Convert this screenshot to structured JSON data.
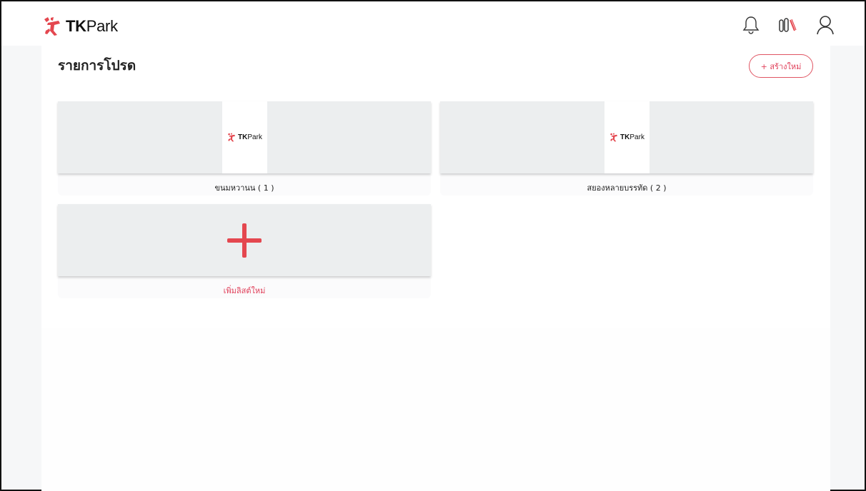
{
  "header": {
    "logo": {
      "bold": "TK",
      "regular": "Park"
    },
    "icons": [
      "bell-icon",
      "bookshelf-icon",
      "user-icon"
    ]
  },
  "main": {
    "title": "รายการโปรด",
    "create_label": "+ สร้างใหม่",
    "lists": [
      {
        "label": "ขนมหวานน ( 1 )",
        "thumb_logo": {
          "bold": "TK",
          "regular": "Park"
        }
      },
      {
        "label": "สยองหลายบรรทัด ( 2 )",
        "thumb_logo": {
          "bold": "TK",
          "regular": "Park"
        }
      }
    ],
    "add_list_label": "เพิ่มลิสต์ใหม่"
  },
  "colors": {
    "accent": "#e0405a",
    "logo_red": "#e4474f",
    "card_bg": "#eceeef"
  }
}
